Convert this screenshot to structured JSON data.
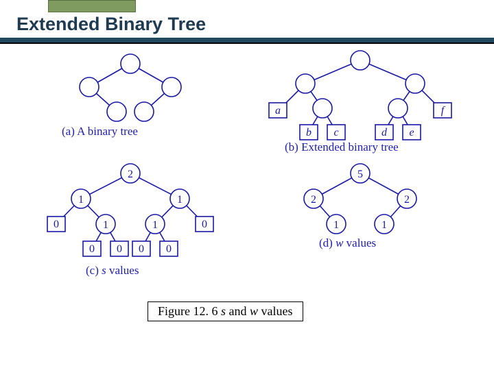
{
  "slide": {
    "title": "Extended Binary Tree"
  },
  "panels": {
    "a": {
      "caption": "(a) A binary tree"
    },
    "b": {
      "caption": "(b) Extended binary tree",
      "leaves": [
        "a",
        "b",
        "c",
        "d",
        "e",
        "f"
      ]
    },
    "c": {
      "caption_pre": "(c) ",
      "caption_mid": "s",
      "caption_post": " values",
      "root": "2",
      "level1": [
        "1",
        "1"
      ],
      "level2": [
        "0",
        "1",
        "1",
        "0"
      ],
      "level3": [
        "0",
        "0",
        "0",
        "0"
      ]
    },
    "d": {
      "caption_pre": "(d) ",
      "caption_mid": "w",
      "caption_post": " values",
      "root": "5",
      "level1": [
        "2",
        "2"
      ],
      "level2": [
        "1",
        "1"
      ]
    }
  },
  "figure": {
    "pre": "Figure 12. 6 ",
    "s": "s",
    "mid": " and ",
    "w": "w",
    "post": " values"
  }
}
